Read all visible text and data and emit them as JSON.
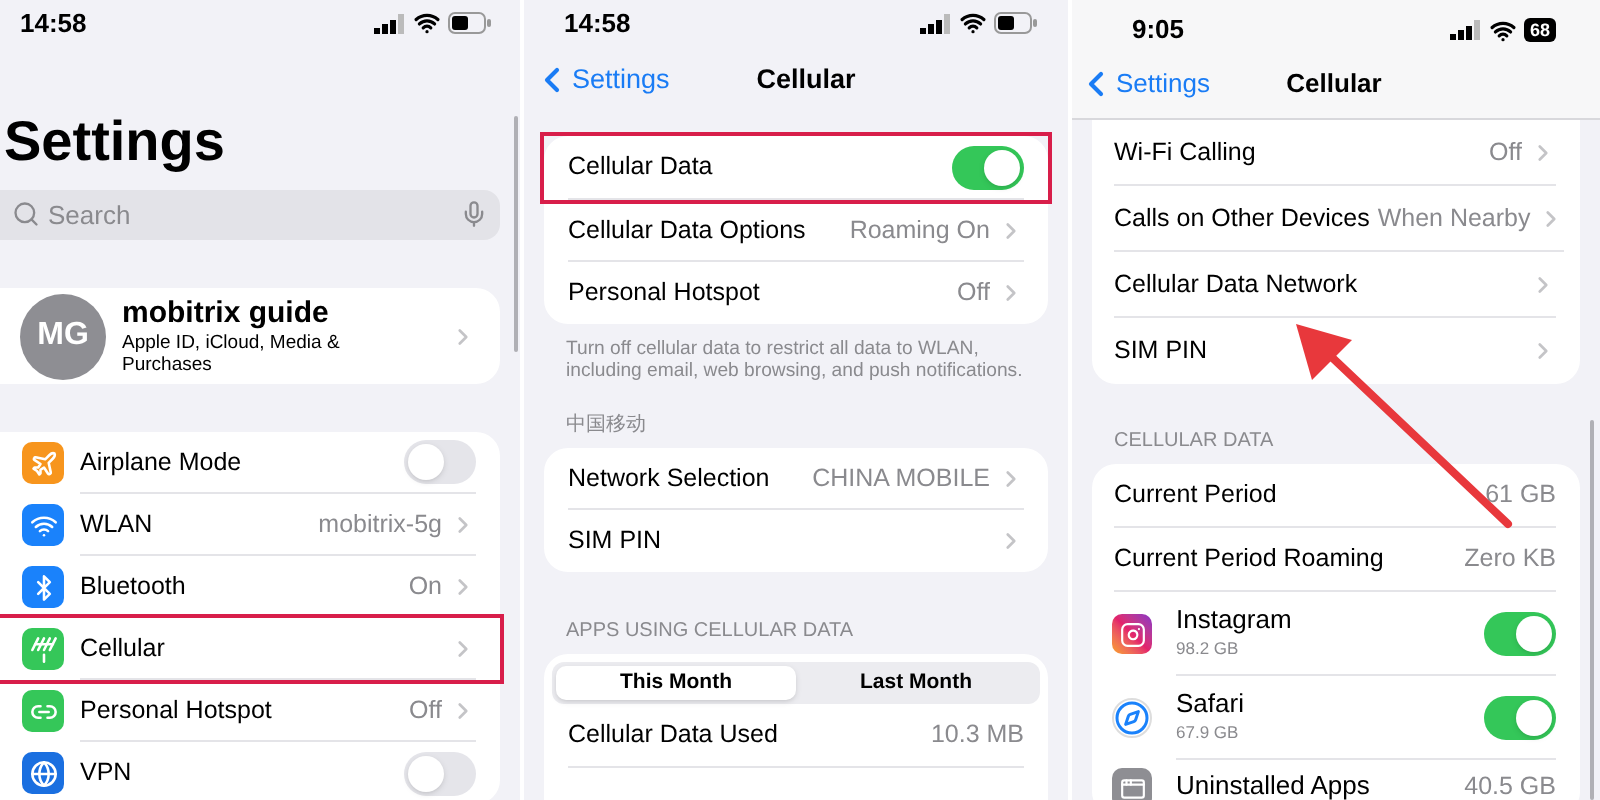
{
  "settings_screen": {
    "status_time": "14:58",
    "title": "Settings",
    "search": {
      "placeholder": "Search"
    },
    "profile": {
      "initials": "MG",
      "name": "mobitrix guide",
      "subtitle": "Apple ID, iCloud, Media & Purchases"
    },
    "rows": [
      {
        "kind": "toggle",
        "label": "Airplane Mode",
        "on": false,
        "color": "#f7951d",
        "highlighted": false
      },
      {
        "kind": "link",
        "label": "WLAN",
        "value": "mobitrix-5g",
        "color": "#1a82fb",
        "highlighted": false
      },
      {
        "kind": "link",
        "label": "Bluetooth",
        "value": "On",
        "color": "#1a82fb",
        "highlighted": false
      },
      {
        "kind": "link",
        "label": "Cellular",
        "color": "#35c759",
        "highlighted": true
      },
      {
        "kind": "link",
        "label": "Personal Hotspot",
        "value": "Off",
        "color": "#35c759",
        "highlighted": false
      },
      {
        "kind": "toggle",
        "label": "VPN",
        "on": false,
        "color": "#1a6fe0",
        "highlighted": false
      }
    ]
  },
  "cellular_screen": {
    "status_time": "14:58",
    "back": "Settings",
    "title": "Cellular",
    "data_rows": [
      {
        "kind": "toggle",
        "label": "Cellular Data",
        "on": true,
        "highlighted": true
      },
      {
        "kind": "link",
        "label": "Cellular Data Options",
        "value": "Roaming On",
        "highlighted": false
      },
      {
        "kind": "link",
        "label": "Personal Hotspot",
        "value": "Off",
        "highlighted": false
      }
    ],
    "footnote": "Turn off cellular data to restrict all data to WLAN, including email, web browsing, and push notifications.",
    "carrier_header": "中国移动",
    "carrier_rows": [
      {
        "kind": "link",
        "label": "Network Selection",
        "value": "CHINA MOBILE"
      },
      {
        "kind": "link",
        "label": "SIM PIN"
      }
    ],
    "apps_header": "APPS USING CELLULAR DATA",
    "segments": [
      {
        "label": "This Month",
        "selected": true
      },
      {
        "label": "Last Month",
        "selected": false
      }
    ],
    "usage_rows": [
      {
        "kind": "value",
        "label": "Cellular Data Used",
        "value": "10.3 MB"
      }
    ]
  },
  "cellular_screen_2": {
    "status_time": "9:05",
    "battery": "68",
    "back": "Settings",
    "title": "Cellular",
    "call_rows": [
      {
        "kind": "link",
        "label": "Wi-Fi Calling",
        "value": "Off"
      },
      {
        "kind": "link",
        "label": "Calls on Other Devices",
        "value": "When Nearby"
      },
      {
        "kind": "link",
        "label": "Cellular Data Network"
      },
      {
        "kind": "link",
        "label": "SIM PIN"
      }
    ],
    "data_header": "CELLULAR DATA",
    "data_rows": [
      {
        "kind": "value",
        "label": "Current Period",
        "value": "61 GB"
      },
      {
        "kind": "value",
        "label": "Current Period Roaming",
        "value": "Zero KB"
      },
      {
        "kind": "app",
        "label": "Instagram",
        "detail": "98.2 GB",
        "on": true
      },
      {
        "kind": "app",
        "label": "Safari",
        "detail": "67.9 GB",
        "on": true
      },
      {
        "kind": "app_value",
        "label": "Uninstalled Apps",
        "value": "40.5 GB"
      }
    ]
  }
}
